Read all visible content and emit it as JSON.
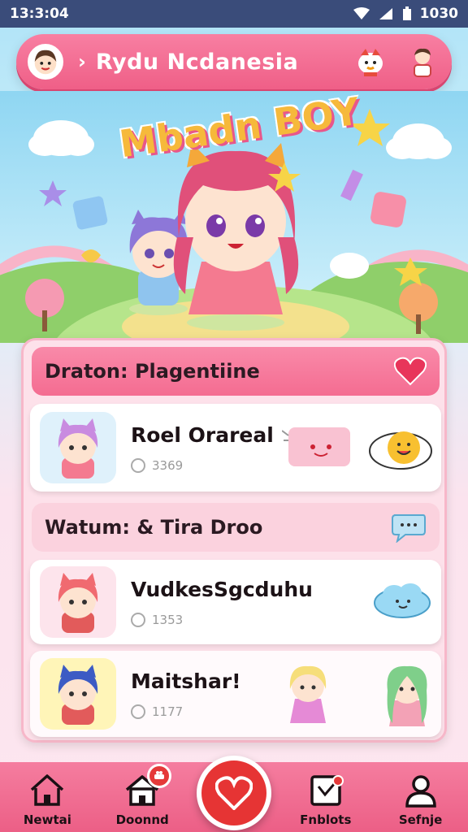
{
  "status_bar": {
    "time": "13:3:04",
    "battery_text": "1030"
  },
  "header": {
    "title": "Rydu Ncdanesia",
    "chevron": "›"
  },
  "hero": {
    "title": "Mbadn BOY"
  },
  "sections": [
    {
      "title": "Draton: Plagentiine",
      "items": [
        {
          "name": "Roel Orareal",
          "meta": "3369"
        }
      ]
    },
    {
      "title": "Watum: & Tira Droo",
      "items": [
        {
          "name": "VudkesSgcduhu",
          "meta": "1353"
        },
        {
          "name": "Maitshar!",
          "meta": "1177"
        }
      ]
    }
  ],
  "bottom_nav": {
    "items": [
      {
        "label": "Newtai",
        "icon": "home-icon"
      },
      {
        "label": "Doonnd",
        "icon": "house-notification-icon"
      },
      {
        "label": "Fnblots",
        "icon": "calendar-icon"
      },
      {
        "label": "Sefnje",
        "icon": "profile-icon"
      }
    ],
    "fab_icon": "heart-icon"
  },
  "colors": {
    "primary_pink": "#ef5f87",
    "status_bar": "#3a4c7a",
    "fab_red": "#e63434",
    "card_bg": "#fde1ea"
  }
}
